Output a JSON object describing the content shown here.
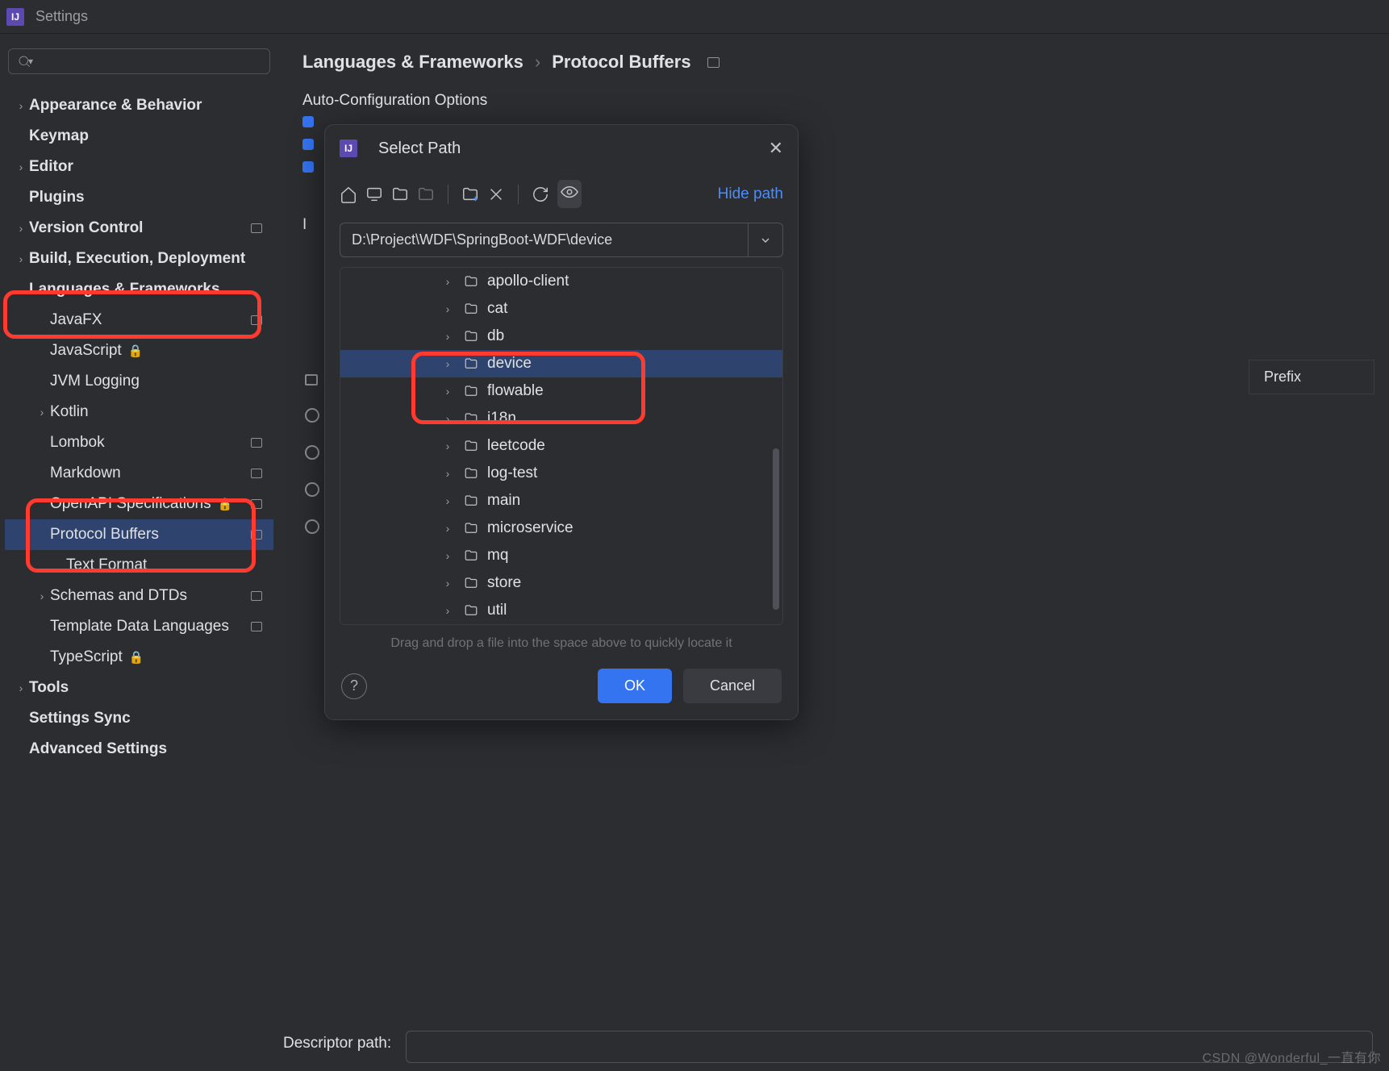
{
  "window": {
    "title": "Settings"
  },
  "breadcrumb": {
    "a": "Languages & Frameworks",
    "b": "Protocol Buffers"
  },
  "section": {
    "auto_config": "Auto-Configuration Options",
    "import_partial": "I",
    "descriptor_label": "Descriptor path:",
    "prefix_header": "Prefix"
  },
  "sidebar": [
    {
      "label": "Appearance & Behavior",
      "expandable": true
    },
    {
      "label": "Keymap"
    },
    {
      "label": "Editor",
      "expandable": true
    },
    {
      "label": "Plugins"
    },
    {
      "label": "Version Control",
      "expandable": true,
      "box": true
    },
    {
      "label": "Build, Execution, Deployment",
      "expandable": true
    },
    {
      "label": "Languages & Frameworks",
      "expandable": true,
      "expanded": true
    },
    {
      "label": "JavaFX",
      "sub": true,
      "box": true
    },
    {
      "label": "JavaScript",
      "sub": true,
      "lock": true
    },
    {
      "label": "JVM Logging",
      "sub": true
    },
    {
      "label": "Kotlin",
      "sub": true,
      "expandable": true
    },
    {
      "label": "Lombok",
      "sub": true,
      "box": true
    },
    {
      "label": "Markdown",
      "sub": true,
      "box": true
    },
    {
      "label": "OpenAPI Specifications",
      "sub": true,
      "lock": true,
      "box": true
    },
    {
      "label": "Protocol Buffers",
      "sub": true,
      "box": true,
      "selected": true
    },
    {
      "label": "Text Format",
      "subsub": true
    },
    {
      "label": "Schemas and DTDs",
      "sub": true,
      "expandable": true,
      "box": true
    },
    {
      "label": "Template Data Languages",
      "sub": true,
      "box": true
    },
    {
      "label": "TypeScript",
      "sub": true,
      "lock": true
    },
    {
      "label": "Tools",
      "expandable": true
    },
    {
      "label": "Settings Sync"
    },
    {
      "label": "Advanced Settings"
    }
  ],
  "dialog": {
    "title": "Select Path",
    "hide_path": "Hide path",
    "path_value": "D:\\Project\\WDF\\SpringBoot-WDF\\device",
    "folders": [
      {
        "name": "apollo-client",
        "expandable": true
      },
      {
        "name": "cat",
        "expandable": true
      },
      {
        "name": "db",
        "expandable": true
      },
      {
        "name": "device",
        "expandable": true,
        "selected": true
      },
      {
        "name": "flowable",
        "expandable": true
      },
      {
        "name": "i18n",
        "expandable": true
      },
      {
        "name": "leetcode",
        "expandable": true
      },
      {
        "name": "log-test",
        "expandable": true
      },
      {
        "name": "main",
        "expandable": true
      },
      {
        "name": "microservice",
        "expandable": true
      },
      {
        "name": "mq",
        "expandable": true
      },
      {
        "name": "store",
        "expandable": true
      },
      {
        "name": "util",
        "expandable": true
      }
    ],
    "drag_hint": "Drag and drop a file into the space above to quickly locate it",
    "ok": "OK",
    "cancel": "Cancel"
  },
  "watermark": "CSDN @Wonderful_一直有你"
}
